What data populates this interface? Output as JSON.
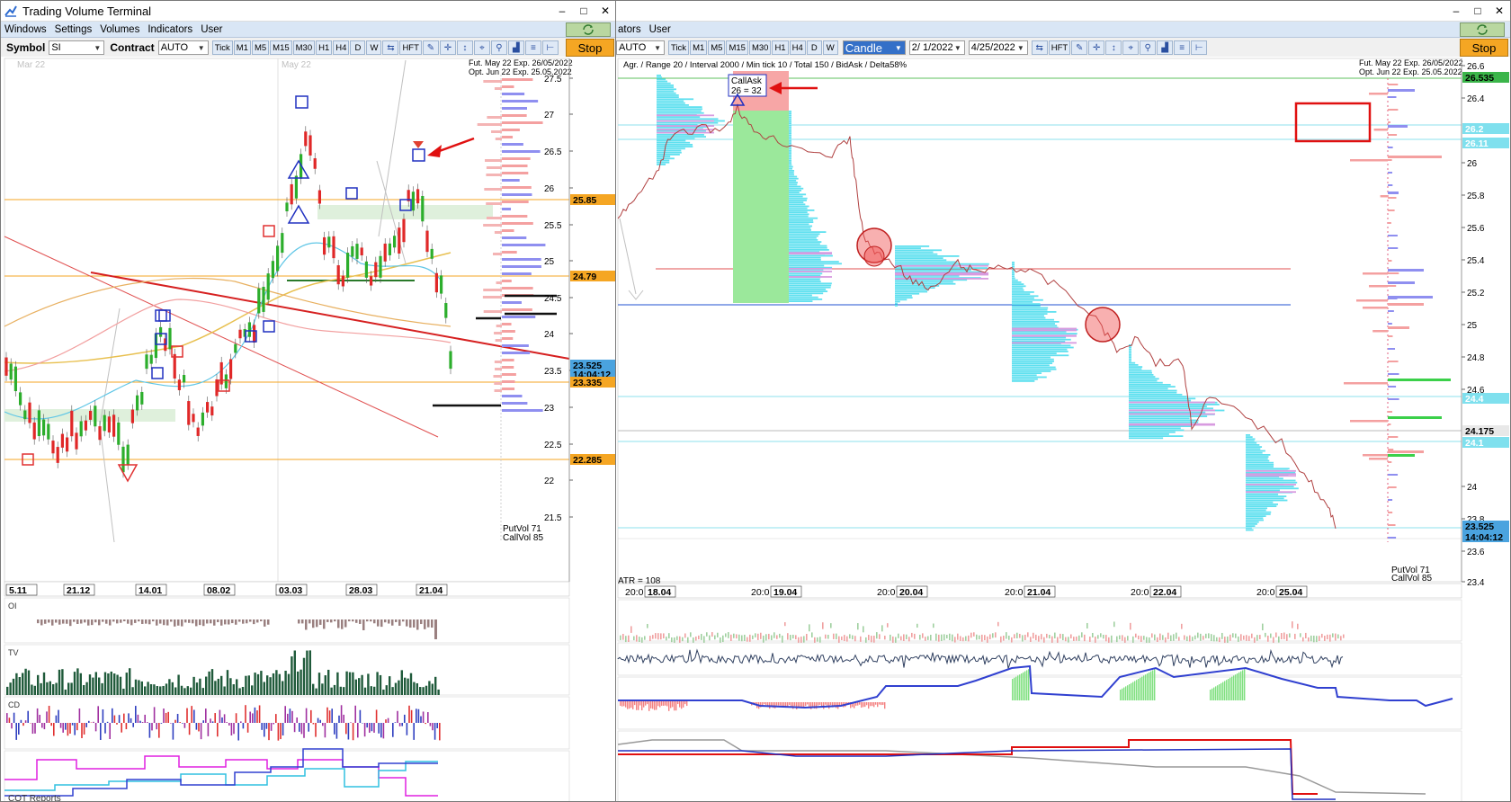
{
  "left": {
    "title": "Trading Volume Terminal",
    "controls": {
      "minimize": "–",
      "maximize": "□",
      "close": "✕"
    },
    "menu": [
      "Windows",
      "Settings",
      "Volumes",
      "Indicators",
      "User"
    ],
    "toolbar": {
      "symbol_label": "Symbol",
      "symbol_value": "SI",
      "contract_label": "Contract",
      "contract_value": "AUTO",
      "timeframes": [
        "Tick",
        "M1",
        "M5",
        "M15",
        "M30",
        "H1",
        "H4",
        "D",
        "W"
      ],
      "hft": "HFT",
      "stop": "Stop"
    },
    "chart": {
      "month_labels": [
        "Mar 22",
        "May 22"
      ],
      "info": [
        "Fut. May 22 Exp. 26/05/2022",
        "Opt. Jun 22 Exp. 25.05.2022"
      ],
      "price_ticks": [
        "27.5",
        "27",
        "26.5",
        "26",
        "25.5",
        "25",
        "24.5",
        "24",
        "23.5",
        "23",
        "22.5",
        "22",
        "21.5"
      ],
      "price_tags": [
        {
          "label": "25.85",
          "color": "#f5a623"
        },
        {
          "label": "24.79",
          "color": "#f5a623"
        },
        {
          "label": "23.525",
          "color": "#4aa3df"
        },
        {
          "label": "14:04:12",
          "color": "#4aa3df"
        },
        {
          "label": "23.335",
          "color": "#f5a623"
        },
        {
          "label": "22.285",
          "color": "#f5a623"
        }
      ],
      "putvol": "PutVol  71",
      "callvol": "CallVol  85",
      "date_labels": [
        "5.11",
        "21.12",
        "14.01",
        "08.02",
        "03.03",
        "28.03",
        "21.04"
      ]
    },
    "panels": {
      "oi": "OI",
      "tv": "TV",
      "cd": "CD",
      "cot": "COT Reports"
    }
  },
  "right": {
    "menu": [
      "ators",
      "User"
    ],
    "toolbar": {
      "contract_value": "AUTO",
      "timeframes": [
        "Tick",
        "M1",
        "M5",
        "M15",
        "M30",
        "H1",
        "H4",
        "D",
        "W"
      ],
      "chart_type": "Candle",
      "date_from": "2/ 1/2022",
      "date_to": "4/25/2022",
      "hft": "HFT",
      "stop": "Stop"
    },
    "chart": {
      "params": "Agr. / Range 20 / Interval 2000 / Min tick 10 / Total 150 / BidAsk / Delta58%",
      "info": [
        "Fut. May 22 Exp. 26/05/2022",
        "Opt. Jun 22 Exp. 25.05.2022"
      ],
      "callask": [
        "CallAsk",
        "26 = 32"
      ],
      "price_ticks": [
        "26.6",
        "26.4",
        "26",
        "25.8",
        "25.6",
        "25.4",
        "25.2",
        "25",
        "24.8",
        "24.6",
        "24",
        "23.8",
        "23.6",
        "23.4"
      ],
      "price_tags": [
        {
          "label": "26.535",
          "color": "#3bb54a"
        },
        {
          "label": "26.2",
          "color": "#7fe0ee"
        },
        {
          "label": "26.11",
          "color": "#7fe0ee"
        },
        {
          "label": "24.4",
          "color": "#7fe0ee"
        },
        {
          "label": "24.175",
          "color": "#e8e8e8"
        },
        {
          "label": "24.1",
          "color": "#7fe0ee"
        },
        {
          "label": "23.525",
          "color": "#4aa3df"
        },
        {
          "label": "14:04:12",
          "color": "#4aa3df"
        }
      ],
      "putvol": "PutVol  71",
      "callvol": "CallVol  85",
      "atr": "ATR = 108",
      "date_labels": [
        {
          "time": "20:0",
          "date": "18.04"
        },
        {
          "time": "20:0",
          "date": "19.04"
        },
        {
          "time": "20:0",
          "date": "20.04"
        },
        {
          "time": "20:0",
          "date": "21.04"
        },
        {
          "time": "20:0",
          "date": "22.04"
        },
        {
          "time": "20:0",
          "date": "25.04"
        }
      ]
    }
  }
}
